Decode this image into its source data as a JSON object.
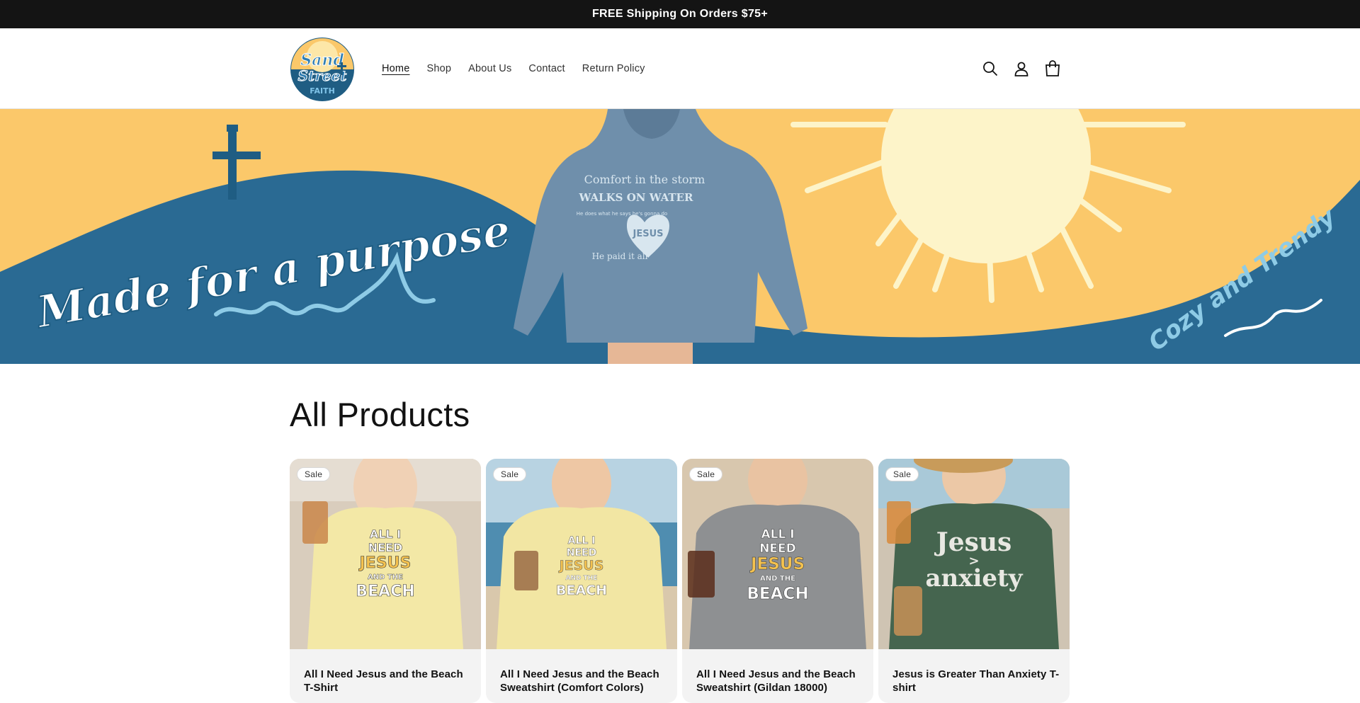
{
  "announcement": {
    "text": "FREE Shipping On Orders $75+"
  },
  "header": {
    "logo_alt": "Sand Street Faith",
    "logo_lines": [
      "Sand",
      "Street",
      "FAITH"
    ],
    "nav": [
      {
        "label": "Home",
        "active": true
      },
      {
        "label": "Shop",
        "active": false
      },
      {
        "label": "About Us",
        "active": false
      },
      {
        "label": "Contact",
        "active": false
      },
      {
        "label": "Return Policy",
        "active": false
      }
    ],
    "icons": [
      "search-icon",
      "account-icon",
      "cart-icon"
    ]
  },
  "hero": {
    "headline": "Made for a purpose",
    "tagline": "Cozy and Trendy",
    "hoodie_lines": [
      "Comfort in the storm",
      "WALKS ON WATER",
      "He does what he says he's gonna do",
      "JESUS",
      "He paid it all"
    ],
    "colors": {
      "sky": "#fbc86a",
      "wave": "#2a6a93",
      "sun": "#fdf4c9"
    }
  },
  "section": {
    "title": "All Products"
  },
  "products": [
    {
      "badge": "Sale",
      "title": "All I Need Jesus and the Beach T-Shirt",
      "shirt_color": "#f3e8a6",
      "print": [
        "ALL I",
        "NEED",
        "JESUS",
        "AND THE",
        "BEACH"
      ]
    },
    {
      "badge": "Sale",
      "title": "All I Need Jesus and the Beach Sweatshirt (Comfort Colors)",
      "shirt_color": "#f2e6a3",
      "print": [
        "ALL I",
        "NEED",
        "JESUS",
        "AND THE",
        "BEACH"
      ]
    },
    {
      "badge": "Sale",
      "title": "All I Need Jesus and the Beach Sweatshirt (Gildan 18000)",
      "shirt_color": "#8e9092",
      "print": [
        "ALL I",
        "NEED",
        "JESUS",
        "AND THE",
        "BEACH"
      ]
    },
    {
      "badge": "Sale",
      "title": "Jesus is Greater Than Anxiety T-shirt",
      "shirt_color": "#45654f",
      "print": [
        "Jesus",
        ">",
        "anxiety"
      ]
    }
  ]
}
